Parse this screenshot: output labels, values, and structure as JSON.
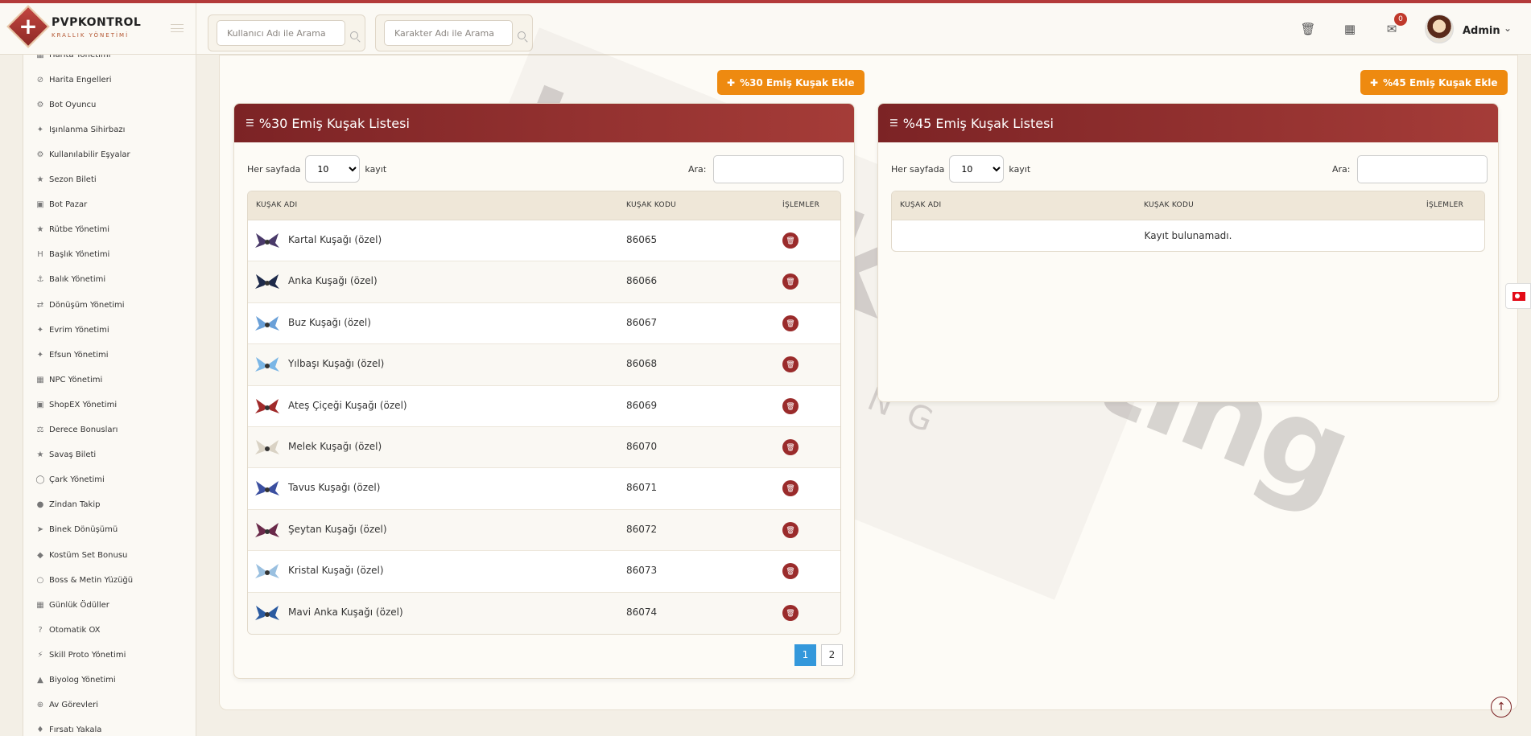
{
  "brand": {
    "title": "PVPKONTROL",
    "subtitle": "KRALLIK YÖNETİMİ"
  },
  "header": {
    "user_search_placeholder": "Kullanıcı Adı ile Arama",
    "char_search_placeholder": "Karakter Adı ile Arama",
    "mail_badge": "0",
    "admin_name": "Admin"
  },
  "sidebar": {
    "items": [
      {
        "label": "Harita Yönetimi",
        "icon": "map-icon"
      },
      {
        "label": "Harita Engelleri",
        "icon": "ban-icon"
      },
      {
        "label": "Bot Oyuncu",
        "icon": "robot-icon"
      },
      {
        "label": "Işınlanma Sihirbazı",
        "icon": "wand-icon"
      },
      {
        "label": "Kullanılabilir Eşyalar",
        "icon": "cogs-icon"
      },
      {
        "label": "Sezon Bileti",
        "icon": "trophy-icon"
      },
      {
        "label": "Bot Pazar",
        "icon": "cart-icon"
      },
      {
        "label": "Rütbe Yönetimi",
        "icon": "star-icon"
      },
      {
        "label": "Başlık Yönetimi",
        "icon": "heading-icon"
      },
      {
        "label": "Balık Yönetimi",
        "icon": "anchor-icon"
      },
      {
        "label": "Dönüşüm Yönetimi",
        "icon": "shuffle-icon"
      },
      {
        "label": "Evrim Yönetimi",
        "icon": "wand-icon"
      },
      {
        "label": "Efsun Yönetimi",
        "icon": "magic-icon"
      },
      {
        "label": "NPC Yönetimi",
        "icon": "bank-icon"
      },
      {
        "label": "ShopEX Yönetimi",
        "icon": "store-icon"
      },
      {
        "label": "Derece Bonusları",
        "icon": "balance-icon"
      },
      {
        "label": "Savaş Bileti",
        "icon": "trophy-icon"
      },
      {
        "label": "Çark Yönetimi",
        "icon": "wheel-icon"
      },
      {
        "label": "Zindan Takip",
        "icon": "pin-icon"
      },
      {
        "label": "Binek Dönüşümü",
        "icon": "rocket-icon"
      },
      {
        "label": "Kostüm Set Bonusu",
        "icon": "gem-icon"
      },
      {
        "label": "Boss & Metin Yüzüğü",
        "icon": "ring-icon"
      },
      {
        "label": "Günlük Ödüller",
        "icon": "calendar-icon"
      },
      {
        "label": "Otomatik OX",
        "icon": "question-icon"
      },
      {
        "label": "Skill Proto Yönetimi",
        "icon": "bolt-icon"
      },
      {
        "label": "Biyolog Yönetimi",
        "icon": "flask-icon"
      },
      {
        "label": "Av Görevleri",
        "icon": "crosshair-icon"
      },
      {
        "label": "Fırsatı Yakala",
        "icon": "tag-icon"
      }
    ]
  },
  "panel30": {
    "add_button": "%30 Emiş Kuşak Ekle",
    "title": "%30 Emiş Kuşak Listesi",
    "per_page_label": "Her sayfada",
    "per_page_value": "10",
    "per_page_suffix": "kayıt",
    "search_label": "Ara:",
    "col_name": "KUŞAK ADI",
    "col_code": "KUŞAK KODU",
    "col_actions": "İŞLEMLER",
    "rows": [
      {
        "name": "Kartal Kuşağı (özel)",
        "code": "86065"
      },
      {
        "name": "Anka Kuşağı (özel)",
        "code": "86066"
      },
      {
        "name": "Buz Kuşağı (özel)",
        "code": "86067"
      },
      {
        "name": "Yılbaşı Kuşağı (özel)",
        "code": "86068"
      },
      {
        "name": "Ateş Çiçeği Kuşağı (özel)",
        "code": "86069"
      },
      {
        "name": "Melek Kuşağı (özel)",
        "code": "86070"
      },
      {
        "name": "Tavus Kuşağı (özel)",
        "code": "86071"
      },
      {
        "name": "Şeytan Kuşağı (özel)",
        "code": "86072"
      },
      {
        "name": "Kristal Kuşağı (özel)",
        "code": "86073"
      },
      {
        "name": "Mavi Anka Kuşağı (özel)",
        "code": "86074"
      }
    ],
    "pages": [
      "1",
      "2"
    ]
  },
  "panel45": {
    "add_button": "%45 Emiş Kuşak Ekle",
    "title": "%45 Emiş Kuşak Listesi",
    "per_page_label": "Her sayfada",
    "per_page_value": "10",
    "per_page_suffix": "kayıt",
    "search_label": "Ara:",
    "col_name": "KUŞAK ADI",
    "col_code": "KUŞAK KODU",
    "col_actions": "İŞLEMLER",
    "empty_text": "Kayıt bulunamadı."
  },
  "watermark": {
    "main": "buyukhosting",
    "sub": "LARGE HOSTING SOLUTIONS"
  },
  "colors": {
    "accent": "#ee8a10",
    "header": "#8e2a2a",
    "active_page": "#3498db"
  }
}
